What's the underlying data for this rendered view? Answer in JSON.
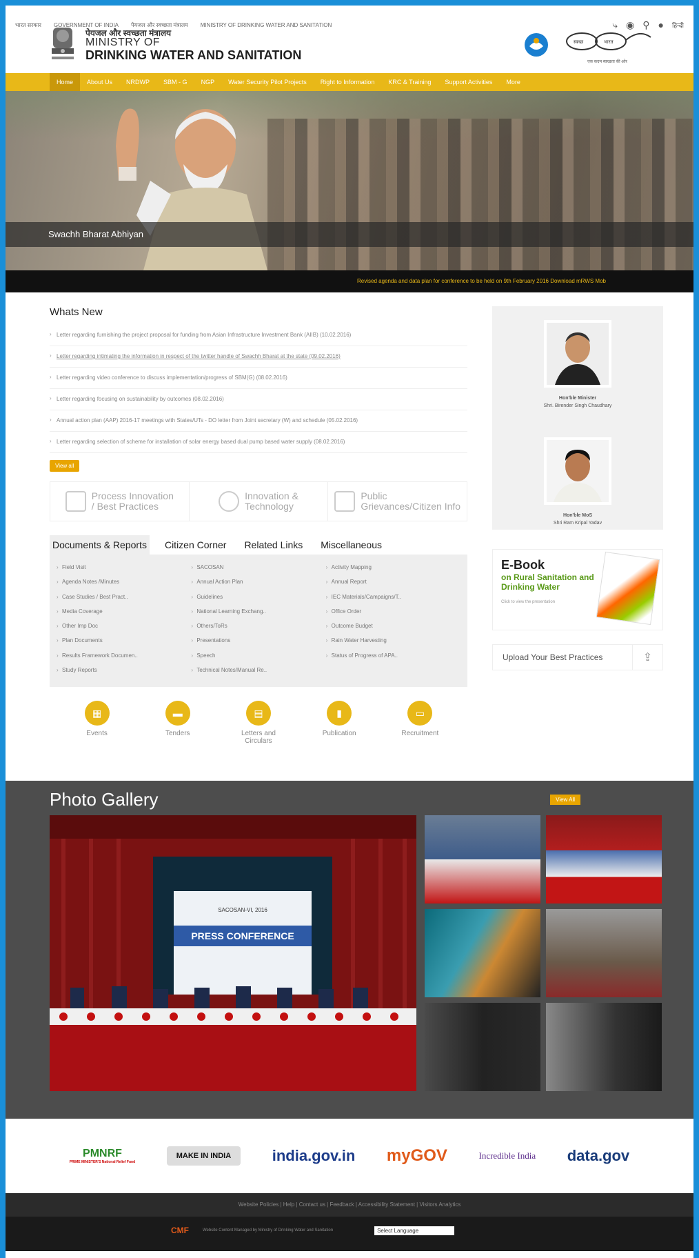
{
  "gov": {
    "hindi": "भारत सरकार",
    "english": "GOVERNMENT OF INDIA",
    "ministry_hi": "पेयजल और स्वच्छता मंत्रालय",
    "ministry_en": "MINISTRY OF DRINKING WATER AND SANITATION",
    "lang": "हिन्दी"
  },
  "header": {
    "hindi": "पेयजल और स्वच्छता मंत्रालय",
    "line1": "MINISTRY OF",
    "line2": "DRINKING WATER AND SANITATION",
    "sb_tag": "एक कदम स्वच्छता की ओर"
  },
  "nav": [
    "Home",
    "About Us",
    "NRDWP",
    "SBM - G",
    "NGP",
    "Water Security Pilot Projects",
    "Right to Information",
    "KRC & Training",
    "Support Activities",
    "More"
  ],
  "banner": {
    "caption": "Swachh Bharat Abhiyan",
    "ticker": "Revised agenda and data plan for conference to be held on 9th February 2016          Download mRWS Mob"
  },
  "whats_new": {
    "title": "Whats New",
    "items": [
      "Letter regarding furnishing the project proposal for funding from Asian Infrastructure Investment Bank (AIIB) (10.02.2016)",
      "Letter regarding intimating the information in respect of the twitter handle of Swachh Bharat at the state (09.02.2016)",
      "Letter regarding video conference to discuss implementation/progress of SBM(G) (08.02.2016)",
      "Letter regarding focusing on sustainability by outcomes (08.02.2016)",
      "Annual action plan (AAP) 2016-17 meetings with States/UTs - DO letter from Joint secretary (W) and schedule (05.02.2016)",
      "Letter regarding selection of scheme for installation of solar energy based dual pump based water supply (08.02.2016)"
    ],
    "view_all": "View all"
  },
  "quick": [
    {
      "l1": "Process Innovation",
      "l2": "/ Best Practices"
    },
    {
      "l1": "Innovation &",
      "l2": "Technology"
    },
    {
      "l1": "Public",
      "l2": "Grievances/Citizen Info"
    }
  ],
  "tabs": [
    "Documents & Reports",
    "Citizen Corner",
    "Related Links",
    "Miscellaneous"
  ],
  "docs": [
    [
      "Field Visit",
      "SACOSAN",
      "Activity Mapping"
    ],
    [
      "Agenda Notes /Minutes",
      "Annual Action Plan",
      "Annual Report"
    ],
    [
      "Case Studies / Best Pract..",
      "Guidelines",
      "IEC Materials/Campaigns/T.."
    ],
    [
      "Media Coverage",
      "National Learning Exchang..",
      "Office Order"
    ],
    [
      "Other Imp Doc",
      "Others/ToRs",
      "Outcome Budget"
    ],
    [
      "Plan Documents",
      "Presentations",
      "Rain Water Harvesting"
    ],
    [
      "Results Framework Documen..",
      "Speech",
      "Status of Progress of APA.."
    ],
    [
      "Study Reports",
      "Technical Notes/Manual Re..",
      ""
    ]
  ],
  "icons": [
    "Events",
    "Tenders",
    "Letters and Circulars",
    "Publication",
    "Recruitment"
  ],
  "minister": {
    "title1": "Hon'ble Minister",
    "name1": "Shri. Birender Singh Chaudhary",
    "title2": "Hon'ble MoS",
    "name2": "Shri Ram Kripal Yadav"
  },
  "ebook": {
    "t1": "E-Book",
    "t2": "on Rural Sanitation and Drinking Water",
    "t3": "Click to view the presentation"
  },
  "upload": "Upload Your Best Practices",
  "gallery": {
    "title": "Photo Gallery",
    "view_all": "View All",
    "press": "PRESS CONFERENCE",
    "sacosan": "SACOSAN-VI, 2016"
  },
  "partners": [
    "PMNRF",
    "MAKE IN INDIA",
    "india.gov.in",
    "myGOV",
    "Incredible India",
    "data.gov"
  ],
  "pmnrf_sub": "PRIME MINISTER'S National Relief Fund",
  "footer": {
    "links": "Website Policies  |  Help  |  Contact us  |  Feedback  |  Accessibility Statement  |  Visitors Analytics",
    "credit": "Website Content Managed by Ministry of Drinking Water and Sanitation",
    "lang_select": "Select Language"
  }
}
